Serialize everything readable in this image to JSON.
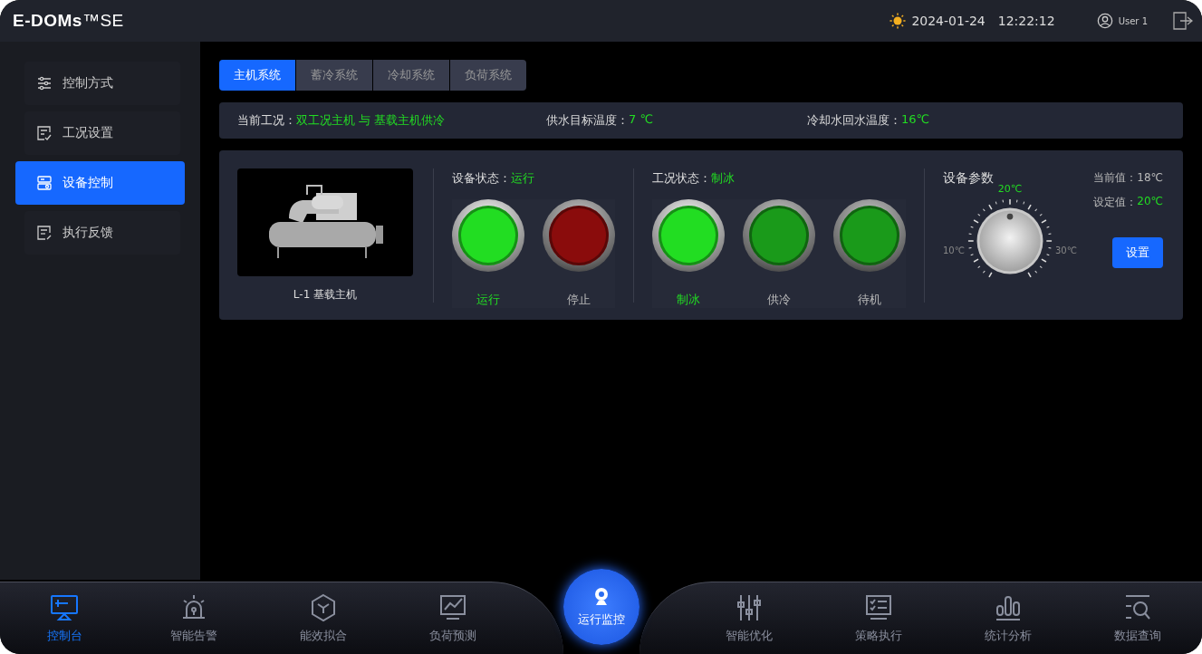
{
  "header": {
    "logo": "**E-DOMs**™SE",
    "date": "2024-01-24",
    "time": "12:22:12",
    "user": "User 1"
  },
  "sidebar": {
    "items": [
      {
        "label": "控制方式",
        "selected": false
      },
      {
        "label": "工况设置",
        "selected": false
      },
      {
        "label": "设备控制",
        "selected": true
      },
      {
        "label": "执行反馈",
        "selected": false
      }
    ]
  },
  "tabs": [
    {
      "label": "主机系统",
      "selected": true
    },
    {
      "label": "蓄冷系统",
      "selected": false
    },
    {
      "label": "冷却系统",
      "selected": false
    },
    {
      "label": "负荷系统",
      "selected": false
    }
  ],
  "info_bar": [
    {
      "label": "当前工况：",
      "value": "双工况主机 与 基载主机供冷"
    },
    {
      "label": "供水目标温度：",
      "value": "7 ℃"
    },
    {
      "label": "冷却水回水温度：",
      "value": "16℃"
    }
  ],
  "device": {
    "name": "L-1 基载主机",
    "status_groups": [
      {
        "label": "设备状态：",
        "value": "运行",
        "lamps": [
          {
            "label": "运行",
            "color": "#22dd22",
            "on": true
          },
          {
            "label": "停止",
            "color": "#8a0c0c",
            "on": false
          }
        ]
      },
      {
        "label": "工况状态：",
        "value": "制冰",
        "lamps": [
          {
            "label": "制冰",
            "color": "#22dd22",
            "on": true
          },
          {
            "label": "供冷",
            "color": "#1a9a1a",
            "on": false
          },
          {
            "label": "待机",
            "color": "#1a9a1a",
            "on": false
          }
        ]
      }
    ],
    "params": {
      "title": "设备参数",
      "current_label": "当前值：",
      "current_value": "18℃",
      "set_label": "设定值：",
      "set_value": "20℃",
      "knob_top": "20℃",
      "knob_min": "10℃",
      "knob_max": "30℃",
      "button": "设置"
    }
  },
  "bottom_nav": {
    "left": [
      {
        "label": "控制台",
        "selected": true
      },
      {
        "label": "智能告警",
        "selected": false
      },
      {
        "label": "能效拟合",
        "selected": false
      },
      {
        "label": "负荷预测",
        "selected": false
      }
    ],
    "center": {
      "label": "运行监控"
    },
    "right": [
      {
        "label": "智能优化",
        "selected": false
      },
      {
        "label": "策略执行",
        "selected": false
      },
      {
        "label": "统计分析",
        "selected": false
      },
      {
        "label": "数据查询",
        "selected": false
      }
    ]
  }
}
